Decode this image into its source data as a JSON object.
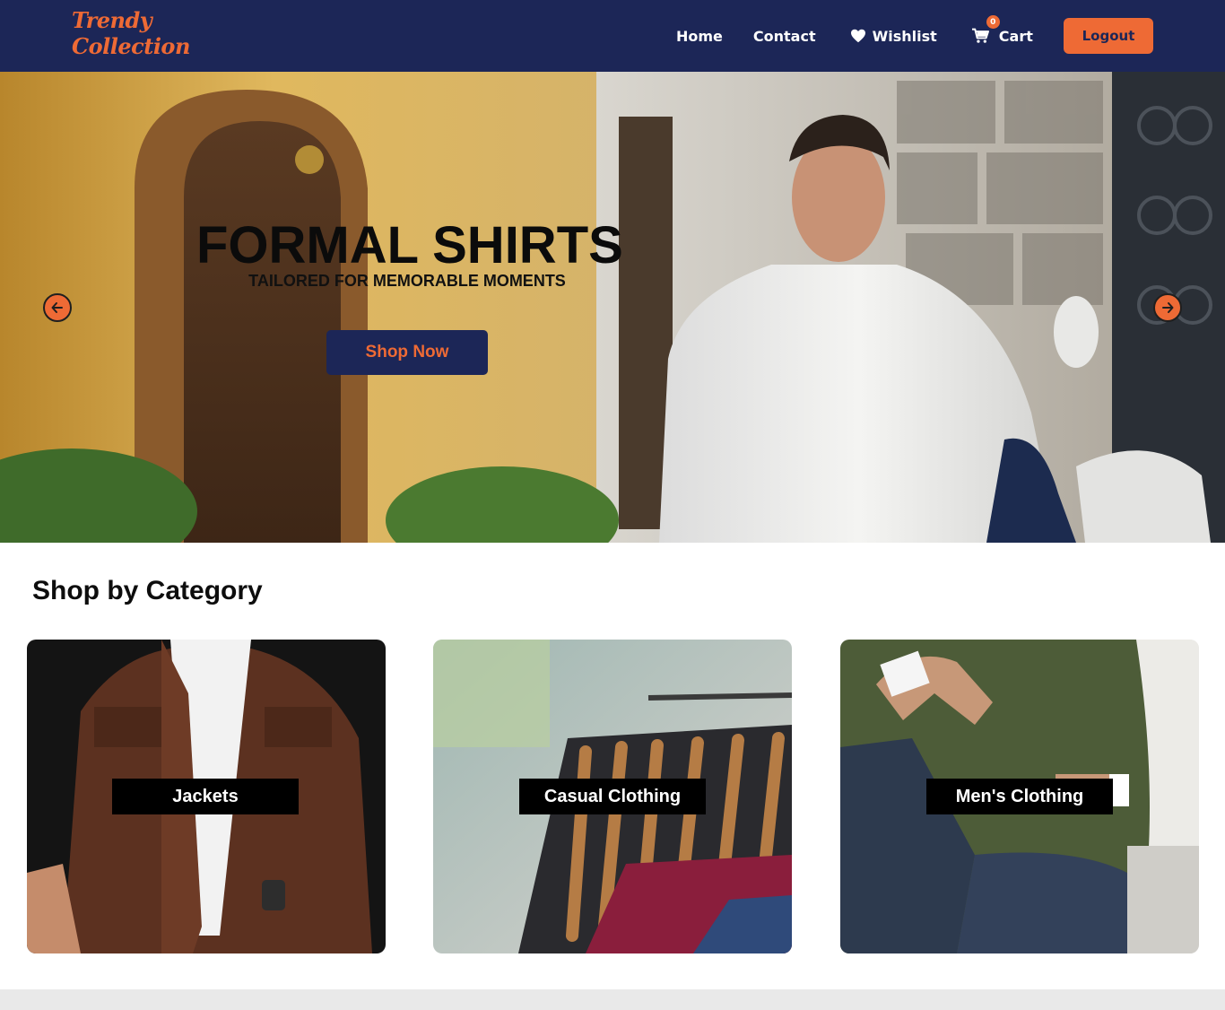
{
  "header": {
    "logo_line1": "Trendy",
    "logo_line2": "Collection",
    "nav": {
      "home": "Home",
      "contact": "Contact",
      "wishlist": "Wishlist",
      "cart": "Cart",
      "cart_count": "0"
    },
    "logout_label": "Logout"
  },
  "hero": {
    "title": "FORMAL SHIRTS",
    "subtitle": "TAILORED FOR MEMORABLE MOMENTS",
    "cta_label": "Shop Now",
    "prev_icon": "arrow-left-icon",
    "next_icon": "arrow-right-icon"
  },
  "categories": {
    "heading": "Shop by Category",
    "items": [
      {
        "label": "Jackets"
      },
      {
        "label": "Casual Clothing"
      },
      {
        "label": "Men's Clothing"
      }
    ]
  },
  "colors": {
    "navy": "#1c2657",
    "accent": "#ee6a35",
    "footer_bg": "#e9e9e9"
  }
}
